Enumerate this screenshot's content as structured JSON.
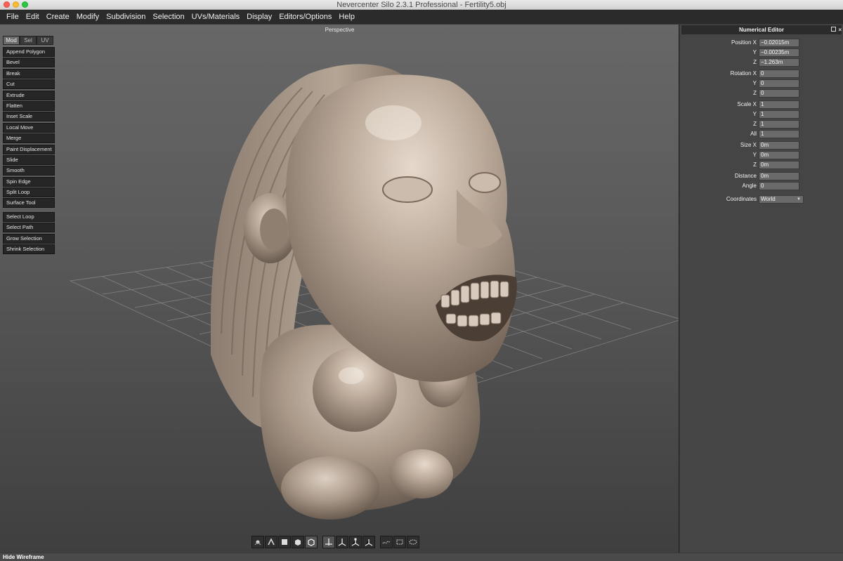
{
  "window": {
    "title": "Nevercenter Silo 2.3.1 Professional - Fertility5.obj"
  },
  "menu": [
    "File",
    "Edit",
    "Create",
    "Modify",
    "Subdivision",
    "Selection",
    "UVs/Materials",
    "Display",
    "Editors/Options",
    "Help"
  ],
  "viewport": {
    "label": "Perspective"
  },
  "tool_tabs": [
    {
      "label": "Mod",
      "active": true
    },
    {
      "label": "Sel",
      "active": false
    },
    {
      "label": "UV",
      "active": false
    }
  ],
  "modify_tools": [
    "Append Polygon",
    "Bevel",
    "Break",
    "Cut",
    "Extrude",
    "Flatten",
    "Inset Scale",
    "Local Move",
    "Merge",
    "Paint Displacement",
    "Slide",
    "Smooth",
    "Spin Edge",
    "Split Loop",
    "Surface Tool"
  ],
  "selection_tools": [
    "Select Loop",
    "Select Path",
    "Grow Selection",
    "Shrink Selection"
  ],
  "viewport_toolbar": [
    {
      "icon": "vertex-mode-icon",
      "active": false
    },
    {
      "icon": "edge-mode-icon",
      "active": false
    },
    {
      "icon": "face-mode-icon",
      "active": false
    },
    {
      "icon": "object-mode-icon",
      "active": false
    },
    {
      "icon": "full-object-mode-icon",
      "active": true
    },
    {
      "icon": "move-manipulator-icon",
      "active": true
    },
    {
      "icon": "rotate-manipulator-icon",
      "active": false
    },
    {
      "icon": "scale-manipulator-icon",
      "active": false
    },
    {
      "icon": "universal-manipulator-icon",
      "active": false
    },
    {
      "icon": "lasso-select-icon",
      "active": false
    },
    {
      "icon": "box-select-icon",
      "active": false
    },
    {
      "icon": "paint-select-icon",
      "active": false
    }
  ],
  "numerical_editor": {
    "title": "Numerical Editor",
    "rows": [
      {
        "label": "Position X",
        "value": "−0.02015m"
      },
      {
        "label": "Y",
        "value": "−0.00235m"
      },
      {
        "label": "Z",
        "value": "−1.263m"
      },
      {
        "label": "Rotation X",
        "value": "0"
      },
      {
        "label": "Y",
        "value": "0"
      },
      {
        "label": "Z",
        "value": "0"
      },
      {
        "label": "Scale X",
        "value": "1"
      },
      {
        "label": "Y",
        "value": "1"
      },
      {
        "label": "Z",
        "value": "1"
      },
      {
        "label": "All",
        "value": "1"
      },
      {
        "label": "Size X",
        "value": "0m"
      },
      {
        "label": "Y",
        "value": "0m"
      },
      {
        "label": "Z",
        "value": "0m"
      },
      {
        "label": "Distance",
        "value": "0m"
      },
      {
        "label": "Angle",
        "value": "0"
      }
    ],
    "coordinates_label": "Coordinates",
    "coordinates_value": "World"
  },
  "statusbar": {
    "text": "Hide Wireframe"
  },
  "colors": {
    "model": "#b8a898",
    "viewport_top": "#676767",
    "viewport_bottom": "#3f3f3f",
    "panel": "#454545"
  }
}
